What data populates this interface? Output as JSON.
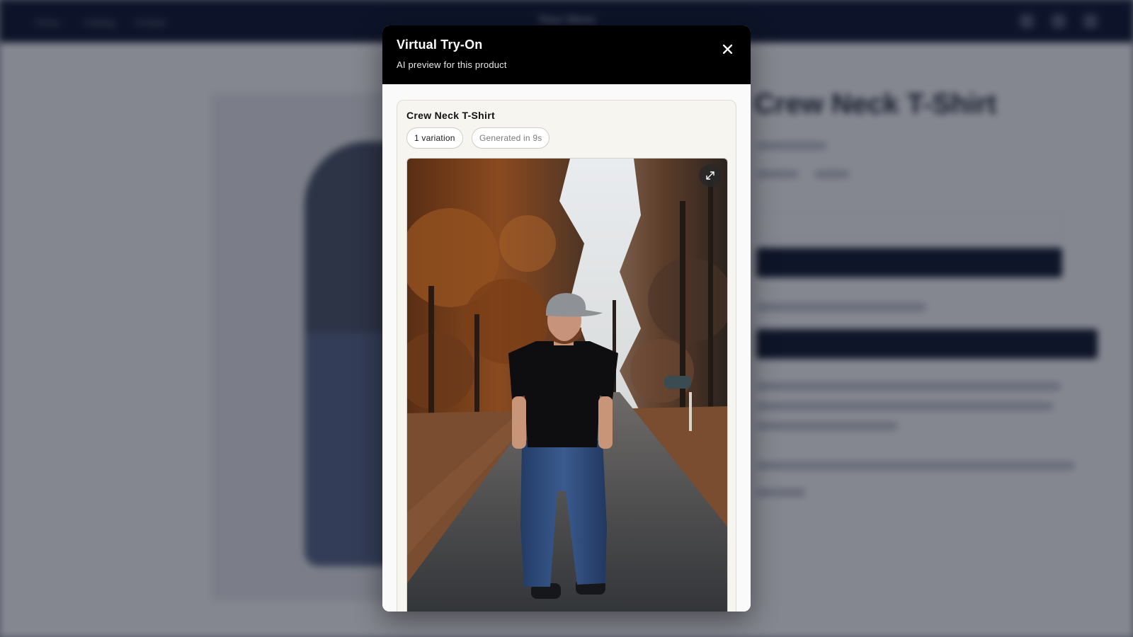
{
  "background": {
    "nav_items": [
      "Home",
      "Catalog",
      "Contact"
    ],
    "store_name": "Your Store",
    "product_title": "Crew Neck T-Shirt"
  },
  "modal": {
    "title": "Virtual Try-On",
    "subtitle": "AI preview for this product",
    "close_icon": "close-icon"
  },
  "result": {
    "product_name": "Crew Neck T-Shirt",
    "variation_label": "1 variation",
    "generated_label": "Generated in 9s",
    "image_alt": "Man in black crew neck t-shirt, grey cap and blue jeans standing on an autumn road",
    "expand_icon": "expand-icon"
  },
  "colors": {
    "header_bg": "#000000",
    "card_bg": "#f7f5ef",
    "shirt": "#0e0e10",
    "jeans": "#2e4a78"
  }
}
